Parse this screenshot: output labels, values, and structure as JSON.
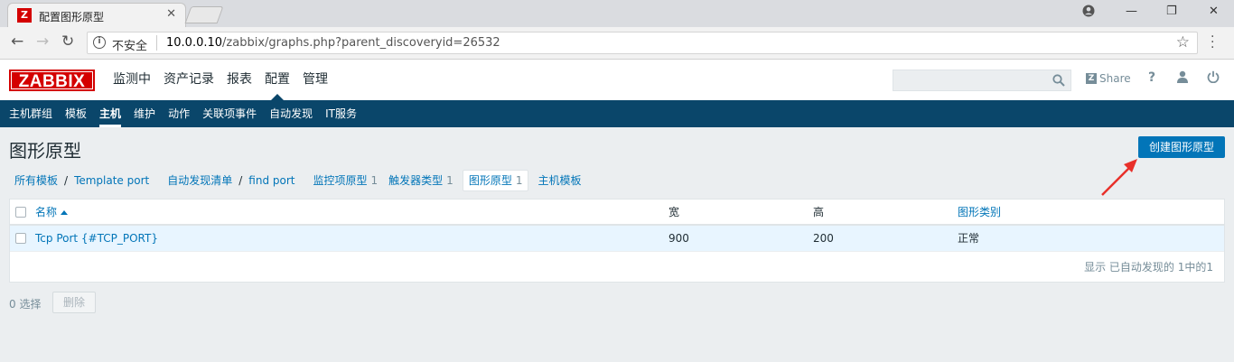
{
  "browser": {
    "tab_title": "配置图形原型",
    "favicon": "Z",
    "security_label": "不安全",
    "url_host": "10.0.0.10",
    "url_path": "/zabbix/graphs.php?parent_discoveryid=26532"
  },
  "header": {
    "logo": "ZABBIX",
    "menu": [
      {
        "label": "监测中"
      },
      {
        "label": "资产记录"
      },
      {
        "label": "报表"
      },
      {
        "label": "配置",
        "active": true
      },
      {
        "label": "管理"
      }
    ],
    "search_placeholder": "",
    "share_label": "Share",
    "help_label": "?"
  },
  "submenu": [
    {
      "label": "主机群组"
    },
    {
      "label": "模板"
    },
    {
      "label": "主机",
      "active": true
    },
    {
      "label": "维护"
    },
    {
      "label": "动作"
    },
    {
      "label": "关联项事件"
    },
    {
      "label": "自动发现"
    },
    {
      "label": "IT服务"
    }
  ],
  "page": {
    "title": "图形原型",
    "create_button": "创建图形原型"
  },
  "breadcrumbs": {
    "all_templates": "所有模板",
    "template": "Template port",
    "discovery_list": "自动发现清单",
    "discovery_rule": "find port",
    "item_prototypes": "监控项原型",
    "item_prototypes_count": "1",
    "trigger_prototypes": "触发器类型",
    "trigger_prototypes_count": "1",
    "graph_prototypes": "图形原型",
    "graph_prototypes_count": "1",
    "host_templates": "主机模板"
  },
  "table": {
    "columns": {
      "name": "名称",
      "width": "宽",
      "height": "高",
      "graph_type": "图形类别"
    },
    "rows": [
      {
        "name": "Tcp Port {#TCP_PORT}",
        "width": "900",
        "height": "200",
        "graph_type": "正常"
      }
    ],
    "footer": "显示 已自动发现的 1中的1"
  },
  "actions": {
    "selected": "0 选择",
    "delete": "删除"
  },
  "colors": {
    "brand_red": "#d40000",
    "nav_blue": "#0a466a",
    "link_blue": "#0275b8",
    "arrow_red": "#e8302a"
  }
}
